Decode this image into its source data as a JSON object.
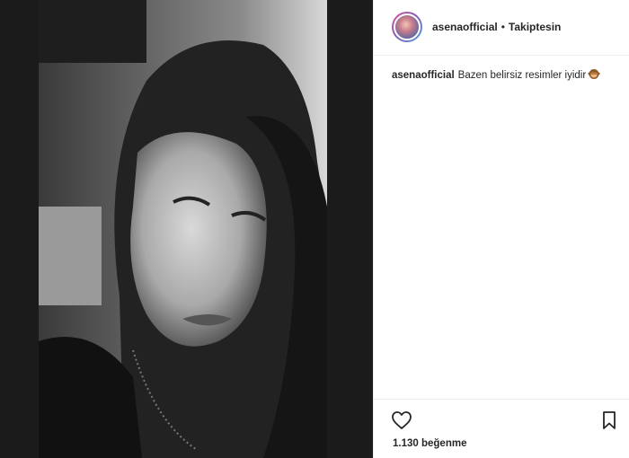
{
  "header": {
    "username": "asenaofficial",
    "separator": "•",
    "follow_status": "Takiptesin"
  },
  "caption": {
    "username": "asenaofficial",
    "text": "Bazen belirsiz resimler iyidir",
    "emoji": "see-no-evil-monkey"
  },
  "actions": {
    "like_icon": "heart-icon",
    "save_icon": "bookmark-icon",
    "likes_count": "1.130",
    "likes_label": "beğenme"
  }
}
